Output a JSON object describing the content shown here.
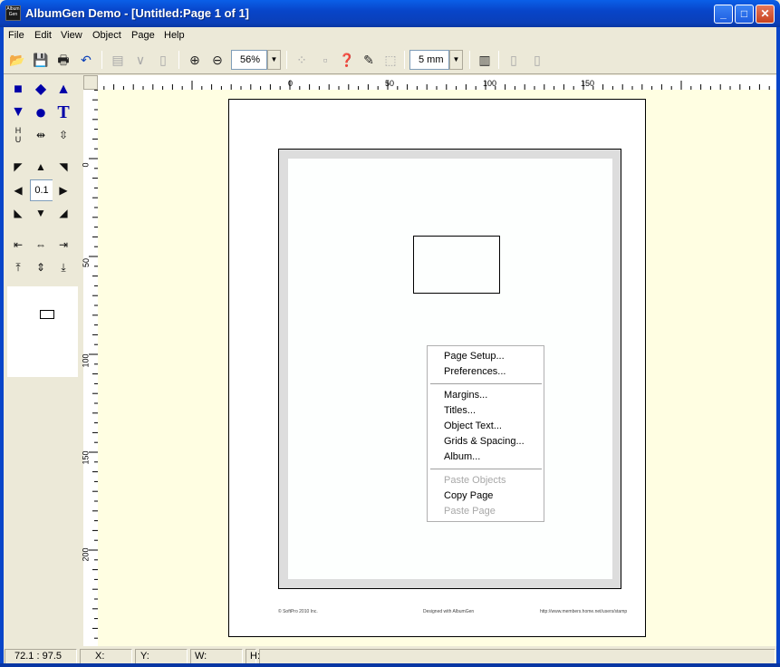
{
  "window": {
    "title": "AlbumGen Demo - [Untitled:Page 1 of 1]",
    "icon_label": "Album Gen"
  },
  "menu": [
    "File",
    "Edit",
    "View",
    "Object",
    "Page",
    "Help"
  ],
  "toolbar": {
    "zoom": "56%",
    "grid_size": "5 mm"
  },
  "palette": {
    "step_value": "0.1"
  },
  "ruler": {
    "top_labels": [
      "0",
      "50",
      "100",
      "150"
    ],
    "left_labels": [
      "0",
      "50",
      "100",
      "150",
      "200"
    ]
  },
  "page": {
    "footer_left": "© SoftPro 2010 Inc.",
    "footer_center": "Designed with AlbumGen",
    "footer_right": "http://www.members.home.net/users/stamp"
  },
  "context_menu": {
    "items": [
      {
        "label": "Page Setup...",
        "enabled": true
      },
      {
        "label": "Preferences...",
        "enabled": true
      },
      {
        "label": "Margins...",
        "enabled": true
      },
      {
        "label": "Titles...",
        "enabled": true
      },
      {
        "label": "Object Text...",
        "enabled": true
      },
      {
        "label": "Grids & Spacing...",
        "enabled": true
      },
      {
        "label": "Album...",
        "enabled": true
      },
      {
        "label": "Paste Objects",
        "enabled": false
      },
      {
        "label": "Copy Page",
        "enabled": true
      },
      {
        "label": "Paste Page",
        "enabled": false
      }
    ]
  },
  "status": {
    "coords": "72.1 : 97.5",
    "x_label": "X:",
    "y_label": "Y:",
    "w_label": "W:",
    "h_label": "H:"
  },
  "icons": [
    "open-icon",
    "save-icon",
    "print-icon",
    "undo-icon",
    "zoom-in-icon",
    "zoom-out-icon",
    "help-icon",
    "grid-icon",
    "album-icon"
  ]
}
